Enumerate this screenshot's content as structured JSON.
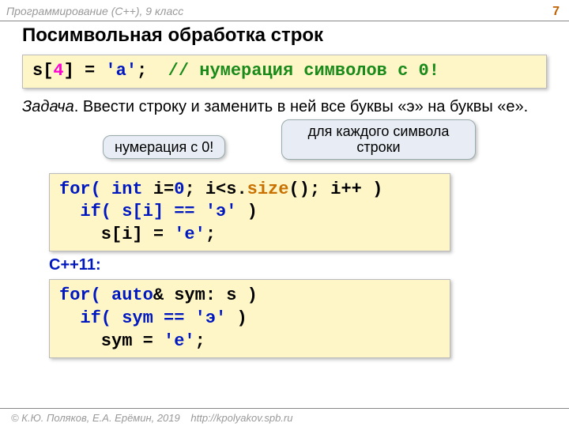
{
  "header": {
    "left": "Программирование (C++), 9 класс",
    "page": "7"
  },
  "title": "Посимвольная обработка строк",
  "code1": {
    "s": "s[",
    "idx": "4",
    "mid": "] =",
    "ch": "'a'",
    "semi": ";  ",
    "cmt": "// нумерация символов с 0!"
  },
  "task": {
    "label": "Задача",
    "text": ". Ввести строку и заменить в ней все буквы «э» на буквы «е»."
  },
  "callout1": "нумерация с 0!",
  "callout2": "для каждого символа строки",
  "code2": {
    "l1a": "for( ",
    "l1b": "int",
    "l1c": " i=",
    "l1d": "0",
    "l1e": "; i<s.",
    "l1f": "size",
    "l1g": "(); i++ )",
    "l2a": "  if( s[i] == ",
    "l2b": "'э'",
    "l2c": " )",
    "l3a": "    s[i] = ",
    "l3b": "'е'",
    "l3c": ";"
  },
  "cpp11": "C++11",
  "colon": ":",
  "code3": {
    "l1a": "for( ",
    "l1b": "auto",
    "l1c": "& sym: s )",
    "l2a": "  if( sym == ",
    "l2b": "'э'",
    "l2c": " )",
    "l3a": "    sym = ",
    "l3b": "'е'",
    "l3c": ";"
  },
  "footer": {
    "copy": "© К.Ю. Поляков, Е.А. Ерёмин, 2019",
    "url": "http://kpolyakov.spb.ru"
  }
}
